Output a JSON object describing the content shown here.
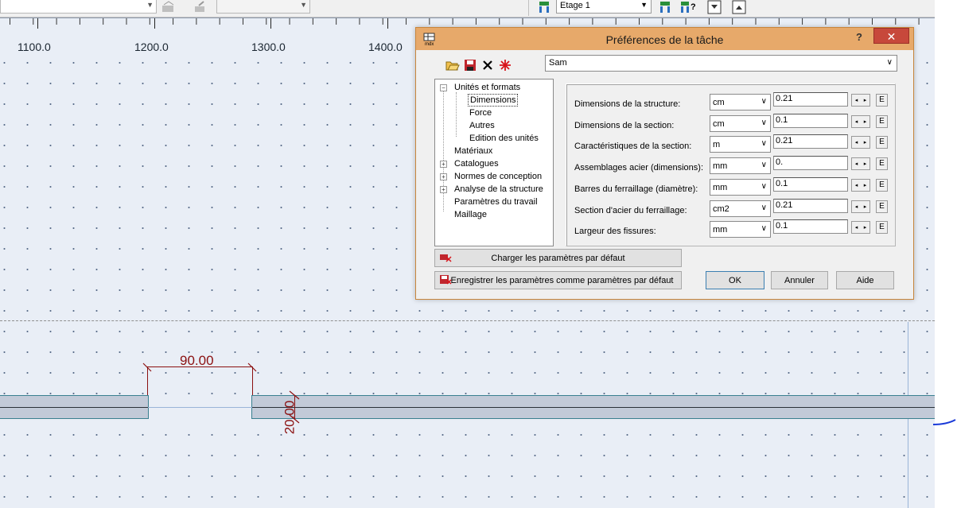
{
  "toolbar": {
    "story_combo_value": "Etage 1",
    "icons": [
      "sheet-icon",
      "sheet-wand-icon",
      "story-icon",
      "story-query-icon",
      "story-down-icon",
      "story-up-icon"
    ]
  },
  "ruler": {
    "labels": [
      "1100.0",
      "1200.0",
      "1300.0",
      "1400.0"
    ]
  },
  "drawing": {
    "dim_horizontal": "90.00",
    "dim_vertical": "20.00"
  },
  "dialog": {
    "title": "Préférences de la tâche",
    "help_label": "?",
    "close_label": "✕",
    "preset_value": "Sam",
    "tree": [
      {
        "label": "Unités et formats",
        "level": 0,
        "expander": "−"
      },
      {
        "label": "Dimensions",
        "level": 1,
        "selected": true
      },
      {
        "label": "Force",
        "level": 1
      },
      {
        "label": "Autres",
        "level": 1
      },
      {
        "label": "Edition des unités",
        "level": 1
      },
      {
        "label": "Matériaux",
        "level": 0
      },
      {
        "label": "Catalogues",
        "level": 0,
        "expander": "+"
      },
      {
        "label": "Normes de conception",
        "level": 0,
        "expander": "+"
      },
      {
        "label": "Analyse de la structure",
        "level": 0,
        "expander": "+"
      },
      {
        "label": "Paramètres du travail",
        "level": 0
      },
      {
        "label": "Maillage",
        "level": 0
      }
    ],
    "params": [
      {
        "label": "Dimensions de la structure:",
        "unit": "cm",
        "value": "0.21"
      },
      {
        "label": "Dimensions de la section:",
        "unit": "cm",
        "value": "0.1"
      },
      {
        "label": "Caractéristiques de la section:",
        "unit": "m",
        "value": "0.21"
      },
      {
        "label": "Assemblages acier (dimensions):",
        "unit": "mm",
        "value": "0."
      },
      {
        "label": "Barres du ferraillage (diamètre):",
        "unit": "mm",
        "value": "0.1"
      },
      {
        "label": "Section d'acier du ferraillage:",
        "unit": "cm2",
        "value": "0.21"
      },
      {
        "label": "Largeur des fissures:",
        "unit": "mm",
        "value": "0.1"
      }
    ],
    "e_label": "E",
    "spin_left": "◂",
    "spin_right": "▸",
    "load_defaults_label": "Charger les paramètres par défaut",
    "save_defaults_label": "Enregistrer les paramètres comme paramètres par défaut",
    "ok_label": "OK",
    "cancel_label": "Annuler",
    "help_button_label": "Aide"
  }
}
